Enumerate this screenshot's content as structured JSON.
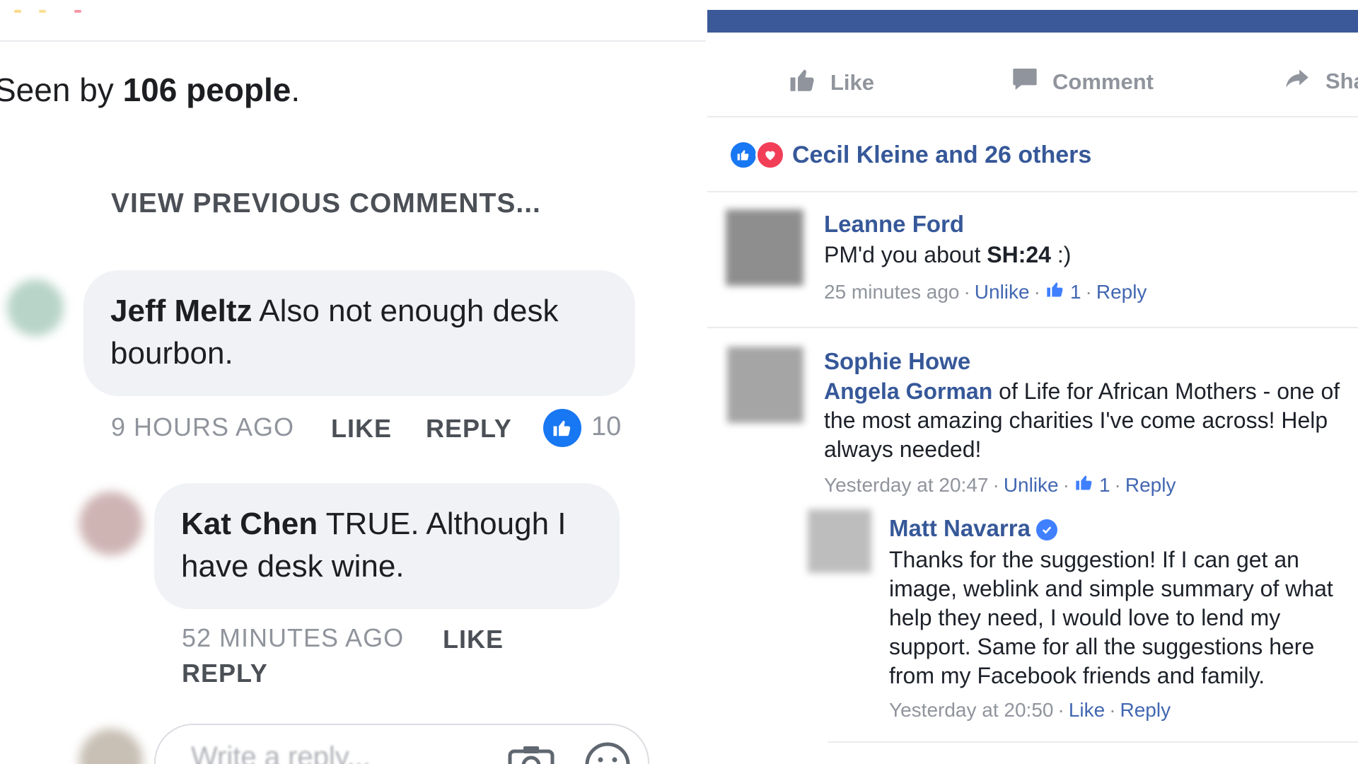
{
  "left": {
    "seen_prefix": "Seen by ",
    "seen_count": "106 people",
    "seen_suffix": ".",
    "view_previous": "VIEW PREVIOUS COMMENTS...",
    "comments": [
      {
        "author": "Jeff Meltz",
        "text_line1": "Also not enough desk",
        "text_line2": "bourbon.",
        "time": "9 HOURS AGO",
        "like_label": "LIKE",
        "reply_label": "REPLY",
        "reaction_count": "10"
      },
      {
        "author": "Kat Chen",
        "text_line1": "TRUE. Although I",
        "text_line2": "have desk wine.",
        "time": "52 MINUTES AGO",
        "like_label": "LIKE",
        "reply_label": "REPLY"
      }
    ],
    "write_placeholder": "Write a reply..."
  },
  "right": {
    "actions": {
      "like": "Like",
      "comment": "Comment",
      "share": "Share"
    },
    "reactions_summary": "Cecil Kleine and 26 others",
    "comments": [
      {
        "author": "Leanne Ford",
        "text_prefix": "PM'd you about ",
        "text_bold": "SH:24",
        "text_suffix": " :)",
        "time": "25 minutes ago",
        "unlike": "Unlike",
        "likes": "1",
        "reply": "Reply"
      },
      {
        "author": "Sophie Howe",
        "mention": "Angela Gorman",
        "text_line1": " of Life for African Mothers - one of",
        "text_line2": "the most amazing charities I've come across! Help",
        "text_line3": "always needed!",
        "time": "Yesterday at 20:47",
        "unlike": "Unlike",
        "likes": "1",
        "reply": "Reply"
      },
      {
        "author": "Matt Navarra",
        "text_line1": "Thanks for the suggestion! If I can get an",
        "text_line2": "image, weblink and simple summary of what",
        "text_line3": "help they need, I would love to lend my",
        "text_line4": "support. Same for all the suggestions here",
        "text_line5": "from my Facebook friends and family.",
        "time": "Yesterday at 20:50",
        "like": "Like",
        "reply": "Reply"
      }
    ]
  },
  "colors": {
    "facebook_blue": "#3b5998",
    "link_blue": "#365899",
    "reaction_blue": "#1877f2",
    "love_red": "#f33e58",
    "meta_gray": "#90949c",
    "bubble_gray": "#f0f2f5"
  },
  "icons": [
    "like-thumb-icon",
    "comment-icon",
    "share-arrow-icon",
    "like-reaction-icon",
    "love-reaction-icon",
    "verified-badge-icon",
    "camera-icon",
    "emoji-icon"
  ]
}
